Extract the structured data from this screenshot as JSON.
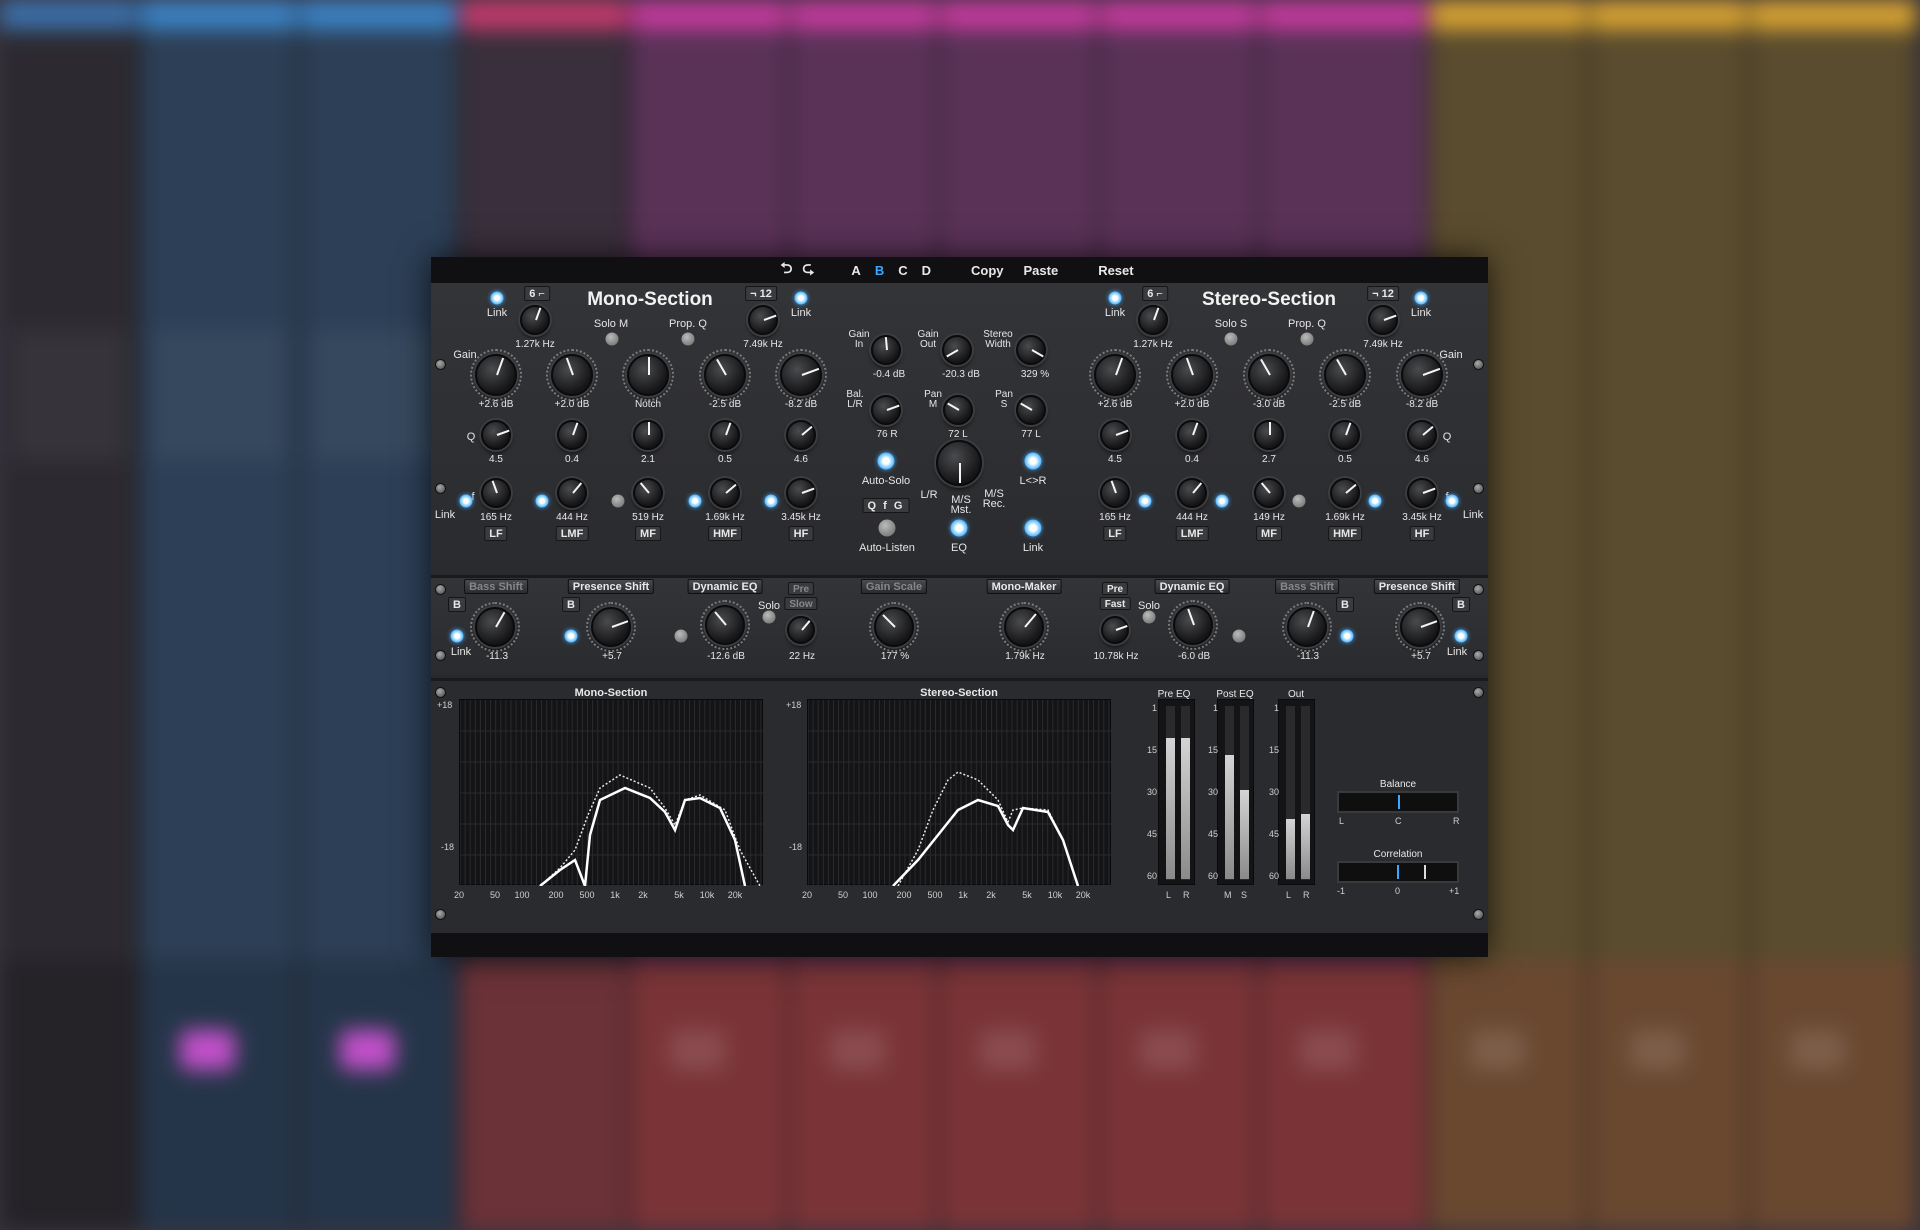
{
  "topbar": {
    "undo": "⮌",
    "redo": "⮎",
    "ab": [
      "A",
      "B",
      "C",
      "D"
    ],
    "active_slot": "B",
    "copy": "Copy",
    "paste": "Paste",
    "reset": "Reset"
  },
  "mono": {
    "title": "Mono-Section",
    "link": "Link",
    "hp_slope": "6",
    "lp_slope": "12",
    "hp_freq": "1.27k Hz",
    "lp_freq": "7.49k Hz",
    "solo": "Solo M",
    "prop_q": "Prop. Q",
    "gain_label": "Gain",
    "q_label": "Q",
    "f_label": "f",
    "gains": [
      "+2.6 dB",
      "+2.0 dB",
      "Notch",
      "-2.5 dB",
      "-8.2 dB"
    ],
    "qs": [
      "4.5",
      "0.4",
      "2.1",
      "0.5",
      "4.6"
    ],
    "freqs": [
      "165 Hz",
      "444 Hz",
      "519 Hz",
      "1.69k Hz",
      "3.45k Hz"
    ],
    "bands": [
      "LF",
      "LMF",
      "MF",
      "HMF",
      "HF"
    ]
  },
  "stereo": {
    "title": "Stereo-Section",
    "link": "Link",
    "hp_slope": "6",
    "lp_slope": "12",
    "hp_freq": "1.27k Hz",
    "lp_freq": "7.49k Hz",
    "solo": "Solo S",
    "prop_q": "Prop. Q",
    "gain_label": "Gain",
    "q_label": "Q",
    "f_label": "f",
    "gains": [
      "+2.6 dB",
      "+2.0 dB",
      "-3.0 dB",
      "-2.5 dB",
      "-8.2 dB"
    ],
    "qs": [
      "4.5",
      "0.4",
      "2.7",
      "0.5",
      "4.6"
    ],
    "freqs": [
      "165 Hz",
      "444 Hz",
      "149 Hz",
      "1.69k Hz",
      "3.45k Hz"
    ],
    "bands": [
      "LF",
      "LMF",
      "MF",
      "HMF",
      "HF"
    ]
  },
  "center": {
    "gain_in": "Gain\nIn",
    "gain_in_val": "-0.4 dB",
    "gain_out": "Gain\nOut",
    "gain_out_val": "-20.3 dB",
    "stereo_width": "Stereo\nWidth",
    "stereo_width_val": "329 %",
    "bal": "Bal.\nL/R",
    "bal_val": "76 R",
    "pan_m": "Pan\nM",
    "pan_m_val": "72 L",
    "pan_s": "Pan\nS",
    "pan_s_val": "77 L",
    "auto_solo": "Auto-Solo",
    "lr_swap": "L<>R",
    "mode_lr": "L/R",
    "mode_ms_mst": "M/S\nMst.",
    "mode_ms_rec": "M/S\nRec.",
    "qfg": "Q f G",
    "auto_listen": "Auto-Listen",
    "eq": "EQ",
    "link": "Link"
  },
  "fx": {
    "bass_shift": "Bass Shift",
    "b": "B",
    "bass_val": "-11.3",
    "link": "Link",
    "presence_shift": "Presence Shift",
    "presence_val": "+5.7",
    "dyn_eq": "Dynamic EQ",
    "solo": "Solo",
    "pre": "Pre",
    "slow": "Slow",
    "fast": "Fast",
    "dyn_val_m": "-12.6 dB",
    "dyn_freq_m": "22 Hz",
    "gain_scale": "Gain Scale",
    "gain_scale_val": "177 %",
    "mono_maker": "Mono-Maker",
    "mono_maker_val": "1.79k Hz",
    "dyn_freq_s": "10.78k Hz",
    "dyn_val_s": "-6.0 dB",
    "bass_val_s": "-11.3",
    "presence_val_s": "+5.7"
  },
  "analyzer": {
    "mono_title": "Mono-Section",
    "stereo_title": "Stereo-Section",
    "y_top": "+18",
    "y_bot": "-18",
    "x_ticks": [
      "20",
      "50",
      "100",
      "200",
      "500",
      "1k",
      "2k",
      "5k",
      "10k",
      "20k"
    ],
    "pre_eq": "Pre EQ",
    "post_eq": "Post EQ",
    "out": "Out",
    "meter_scale": [
      "1",
      "15",
      "30",
      "45",
      "60"
    ],
    "lr": [
      "L",
      "R"
    ],
    "ms": [
      "M",
      "S"
    ],
    "balance": "Balance",
    "bal_l": "L",
    "bal_c": "C",
    "bal_r": "R",
    "correlation": "Correlation",
    "cor_min": "-1",
    "cor_mid": "0",
    "cor_max": "+1",
    "meters": {
      "pre": [
        0.82,
        0.82
      ],
      "post": [
        0.72,
        0.52
      ],
      "out": [
        0.35,
        0.38
      ]
    },
    "balance_pos": 0.5,
    "correlation_pos": 0.72
  }
}
